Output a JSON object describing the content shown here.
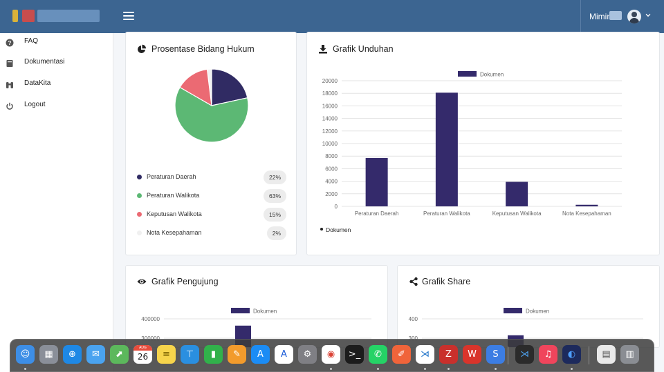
{
  "topbar": {
    "user_name": "Mimin H",
    "colors": {
      "bar": "#3c6591"
    }
  },
  "sidebar": {
    "items": [
      {
        "label": "FAQ",
        "icon": "question-circle-icon"
      },
      {
        "label": "Dokumentasi",
        "icon": "book-icon"
      },
      {
        "label": "DataKita",
        "icon": "binoculars-icon"
      },
      {
        "label": "Logout",
        "icon": "power-icon"
      }
    ]
  },
  "cards": {
    "pie": {
      "title": "Prosentase Bidang Hukum",
      "icon": "pie-chart-icon"
    },
    "downloads": {
      "title": "Grafik Unduhan",
      "icon": "download-icon"
    },
    "visitors": {
      "title": "Grafik Pengujung",
      "icon": "eye-icon"
    },
    "shares": {
      "title": "Grafik Share",
      "icon": "share-icon"
    }
  },
  "chart_data": [
    {
      "type": "pie",
      "title": "Prosentase Bidang Hukum",
      "slices": [
        {
          "name": "Peraturan Daerah",
          "value": 22,
          "label": "22%",
          "color": "#302b63"
        },
        {
          "name": "Peraturan Walikota",
          "value": 63,
          "label": "63%",
          "color": "#5cb874"
        },
        {
          "name": "Keputusan Walikota",
          "value": 15,
          "label": "15%",
          "color": "#eb6a73"
        },
        {
          "name": "Nota Kesepahaman",
          "value": 2,
          "label": "2%",
          "color": "#f2f2f2"
        }
      ],
      "start": "Nota Kesepahaman"
    },
    {
      "type": "bar",
      "title": "Grafik Unduhan",
      "categories": [
        "Peraturan Daerah",
        "Peraturan Walikota",
        "Keputusan Walikota",
        "Nota Kesepahaman"
      ],
      "series": [
        {
          "name": "Dokumen",
          "values": [
            7700,
            18100,
            3900,
            250
          ],
          "color": "#342a6b"
        }
      ],
      "ylim": [
        0,
        20000
      ],
      "yticks": [
        "0",
        "2000",
        "4000",
        "6000",
        "8000",
        "10000",
        "12000",
        "14000",
        "16000",
        "18000",
        "20000"
      ],
      "legend_bottom": "Dokumen",
      "grid": true
    },
    {
      "type": "bar",
      "title": "Grafik Pengujung",
      "series": [
        {
          "name": "Dokumen",
          "values": [
            365000
          ],
          "color": "#342a6b"
        }
      ],
      "yticks_visible": [
        "400000",
        "300000"
      ],
      "partially_visible": true
    },
    {
      "type": "bar",
      "title": "Grafik Share",
      "series": [
        {
          "name": "Dokumen",
          "values": [
            315
          ],
          "color": "#342a6b"
        }
      ],
      "yticks_visible": [
        "400",
        "300"
      ],
      "partially_visible": true
    }
  ],
  "dock": {
    "items": [
      {
        "name": "finder-icon",
        "color": "#3d8ee6",
        "glyph": "☺",
        "running": true
      },
      {
        "name": "launchpad-icon",
        "color": "#8a8f99",
        "glyph": "▦"
      },
      {
        "name": "safari-icon",
        "color": "#1e88e5",
        "glyph": "⊕"
      },
      {
        "name": "mail-icon",
        "color": "#4aa3f0",
        "glyph": "✉"
      },
      {
        "name": "maps-icon",
        "color": "#5cb85c",
        "glyph": "⬈"
      },
      {
        "name": "calendar-icon",
        "color": "#ffffff",
        "glyph": "26",
        "text_color": "#222",
        "badge": "AUG"
      },
      {
        "name": "notes-icon",
        "color": "#f6d44b",
        "glyph": "≡",
        "text_color": "#7a6200"
      },
      {
        "name": "keynote-icon",
        "color": "#2a8fe0",
        "glyph": "⊤"
      },
      {
        "name": "numbers-icon",
        "color": "#31b14b",
        "glyph": "▮"
      },
      {
        "name": "pages-icon",
        "color": "#f29b2c",
        "glyph": "✎"
      },
      {
        "name": "app-store-icon",
        "color": "#1b8cf5",
        "glyph": "A"
      },
      {
        "name": "xcode-instruments-icon",
        "color": "#ffffff",
        "glyph": "A",
        "text_color": "#1b5bd8"
      },
      {
        "name": "system-settings-icon",
        "color": "#7f7f84",
        "glyph": "⚙"
      },
      {
        "name": "chrome-icon",
        "color": "#ffffff",
        "glyph": "◉",
        "text_color": "#db4437",
        "running": true
      },
      {
        "name": "terminal-icon",
        "color": "#1c1c1c",
        "glyph": ">_"
      },
      {
        "name": "whatsapp-icon",
        "color": "#25d366",
        "glyph": "✆",
        "running": true
      },
      {
        "name": "sketch-pen-icon",
        "color": "#f0643a",
        "glyph": "✐"
      },
      {
        "name": "vscode-icon",
        "color": "#ffffff",
        "glyph": "⋊",
        "text_color": "#1e72c8",
        "running": true
      },
      {
        "name": "filezilla-icon",
        "color": "#c9302c",
        "glyph": "Z",
        "running": true
      },
      {
        "name": "wps-office-icon",
        "color": "#d9342b",
        "glyph": "W"
      },
      {
        "name": "s-app-icon",
        "color": "#3c7de3",
        "glyph": "S",
        "running": true
      },
      {
        "name": "vscode-insiders-icon",
        "color": "#2b2b2b",
        "glyph": "⋊",
        "text_color": "#4fa3f0"
      },
      {
        "name": "music-icon",
        "color": "#f0455c",
        "glyph": "♫"
      },
      {
        "name": "firefox-icon",
        "color": "#1d2a5c",
        "glyph": "◐",
        "text_color": "#4fa0ff",
        "running": true
      },
      {
        "name": "scanner-icon",
        "color": "#e9e9e9",
        "glyph": "▤",
        "text_color": "#555"
      },
      {
        "name": "trash-icon",
        "color": "#8a8d93",
        "glyph": "▥"
      }
    ]
  }
}
